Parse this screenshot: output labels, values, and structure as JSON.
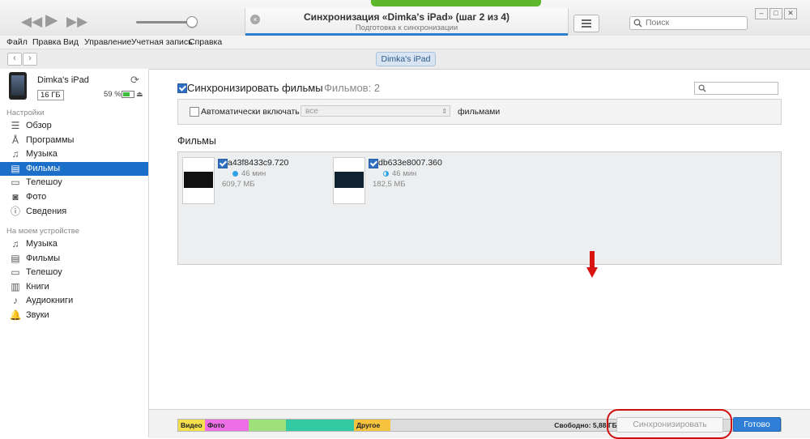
{
  "status": {
    "title": "Синхронизация «Dimka's iPad» (шаг 2 из 4)",
    "subtitle": "Подготовка к синхронизации"
  },
  "search": {
    "placeholder": "Поиск"
  },
  "menu": [
    "Файл",
    "Правка",
    "Вид",
    "Управление",
    "Учетная запись",
    "Справка"
  ],
  "nav": {
    "device_tab": "Dimka's iPad"
  },
  "device": {
    "name": "Dimka's iPad",
    "capacity": "16 ГБ",
    "battery": "59 %"
  },
  "sidebar": {
    "settings_header": "Настройки",
    "settings": [
      {
        "label": "Обзор",
        "icon": "list-icon"
      },
      {
        "label": "Программы",
        "icon": "apps-icon"
      },
      {
        "label": "Музыка",
        "icon": "music-icon"
      },
      {
        "label": "Фильмы",
        "icon": "film-icon",
        "active": true
      },
      {
        "label": "Телешоу",
        "icon": "tv-icon"
      },
      {
        "label": "Фото",
        "icon": "camera-icon"
      },
      {
        "label": "Сведения",
        "icon": "info-icon"
      }
    ],
    "device_header": "На моем устройстве",
    "device_items": [
      {
        "label": "Музыка",
        "icon": "music-icon"
      },
      {
        "label": "Фильмы",
        "icon": "film-icon"
      },
      {
        "label": "Телешоу",
        "icon": "tv-icon"
      },
      {
        "label": "Книги",
        "icon": "book-icon"
      },
      {
        "label": "Аудиокниги",
        "icon": "audiobook-icon"
      },
      {
        "label": "Звуки",
        "icon": "bell-icon"
      }
    ]
  },
  "main": {
    "sync_label": "Синхронизировать фильмы",
    "films_count": "Фильмов: 2",
    "auto_label": "Автоматически включать",
    "auto_value": "все",
    "auto_suffix": "фильмами",
    "films_heading": "Фильмы",
    "films": [
      {
        "title": "a43f8433c9.720",
        "duration": "46 мин",
        "size": "609,7 МБ",
        "checked": true
      },
      {
        "title": "db633e8007.360",
        "duration": "46 мин",
        "size": "182,5 МБ",
        "checked": true
      }
    ]
  },
  "capacity": {
    "video": "Видео",
    "photo": "Фото",
    "other": "Другое",
    "free": "Свободно: 5,88 ГБ",
    "colors": {
      "video": "#f4e04d",
      "photo": "#ee6ee6",
      "apps": "#9ee07a",
      "books": "#33c9a3",
      "other": "#f6c33e",
      "free": "#dcdcdc"
    }
  },
  "buttons": {
    "sync": "Синхронизировать",
    "done": "Готово"
  }
}
